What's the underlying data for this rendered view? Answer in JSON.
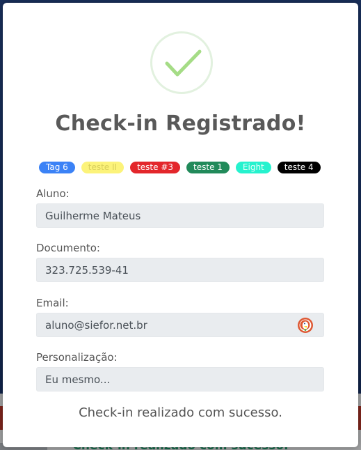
{
  "background": {
    "message": "Check-in realizado com sucesso."
  },
  "modal": {
    "title": "Check-in Registrado!",
    "icon": "check-circle-icon",
    "tags": [
      {
        "label": "Tag 6",
        "bg": "#3b82f6",
        "fg": "#ffffff"
      },
      {
        "label": "teste II",
        "bg": "#fcf37a",
        "fg": "#d8cf5c"
      },
      {
        "label": "teste #3",
        "bg": "#e3262b",
        "fg": "#ffffff"
      },
      {
        "label": "teste 1",
        "bg": "#218a5a",
        "fg": "#ffffff"
      },
      {
        "label": "Eight",
        "bg": "#26f2ce",
        "fg": "#e8fff9"
      },
      {
        "label": "teste 4",
        "bg": "#000000",
        "fg": "#ffffff"
      }
    ],
    "fields": {
      "aluno": {
        "label": "Aluno:",
        "value": "Guilherme Mateus"
      },
      "documento": {
        "label": "Documento:",
        "value": "323.725.539-41"
      },
      "email": {
        "label": "Email:",
        "value": "aluno@siefor.net.br"
      },
      "personalizacao": {
        "label": "Personalização:",
        "value": "Eu mesmo..."
      }
    },
    "message": "Check-in realizado com sucesso."
  },
  "colors": {
    "success_green": "#a5dc86",
    "title": "#595959",
    "input_bg": "#e9ecef"
  }
}
